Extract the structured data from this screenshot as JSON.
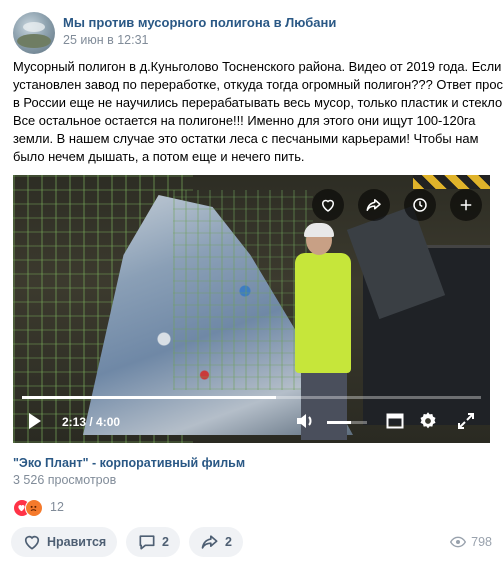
{
  "post": {
    "group_name": "Мы против мусорного полигона в Любани",
    "date": "25 июн в 12:31",
    "text_lines": [
      "Мусорный полигон в д.Куньголово Тосненского района. Видео от 2019 года. Если",
      "установлен завод по переработке, откуда тогда огромный полигон??? Ответ прост,",
      "в России еще не научились перерабатывать весь мусор, только пластик и стекло.",
      "Все остальное остается на полигоне!!! Именно для этого они ищут 100-120га",
      "земли. В нашем случае это остатки леса с песчаными карьерами! Чтобы нам",
      "было нечем дышать, а потом еще и нечего пить."
    ]
  },
  "video": {
    "current_time": "2:13 / 4:00",
    "progress": 0.554,
    "volume": 0.6,
    "title": "\"Эко Плант\" - корпоративный фильм",
    "views": "3 526 просмотров",
    "top_icons": [
      "heart-icon",
      "share-icon",
      "clock-icon",
      "plus-icon"
    ],
    "control_icons": [
      "play-icon",
      "volume-icon",
      "miniplayer-icon",
      "settings-icon",
      "fullscreen-icon"
    ]
  },
  "reactions": {
    "count": "12",
    "types": [
      "like",
      "angry"
    ]
  },
  "actions": {
    "like_label": "Нравится",
    "comments_count": "2",
    "shares_count": "2"
  },
  "views_count": "798",
  "colors": {
    "link": "#2a5885",
    "muted": "#818c99",
    "button_bg": "#f0f2f5",
    "button_text": "#4e5f73"
  }
}
